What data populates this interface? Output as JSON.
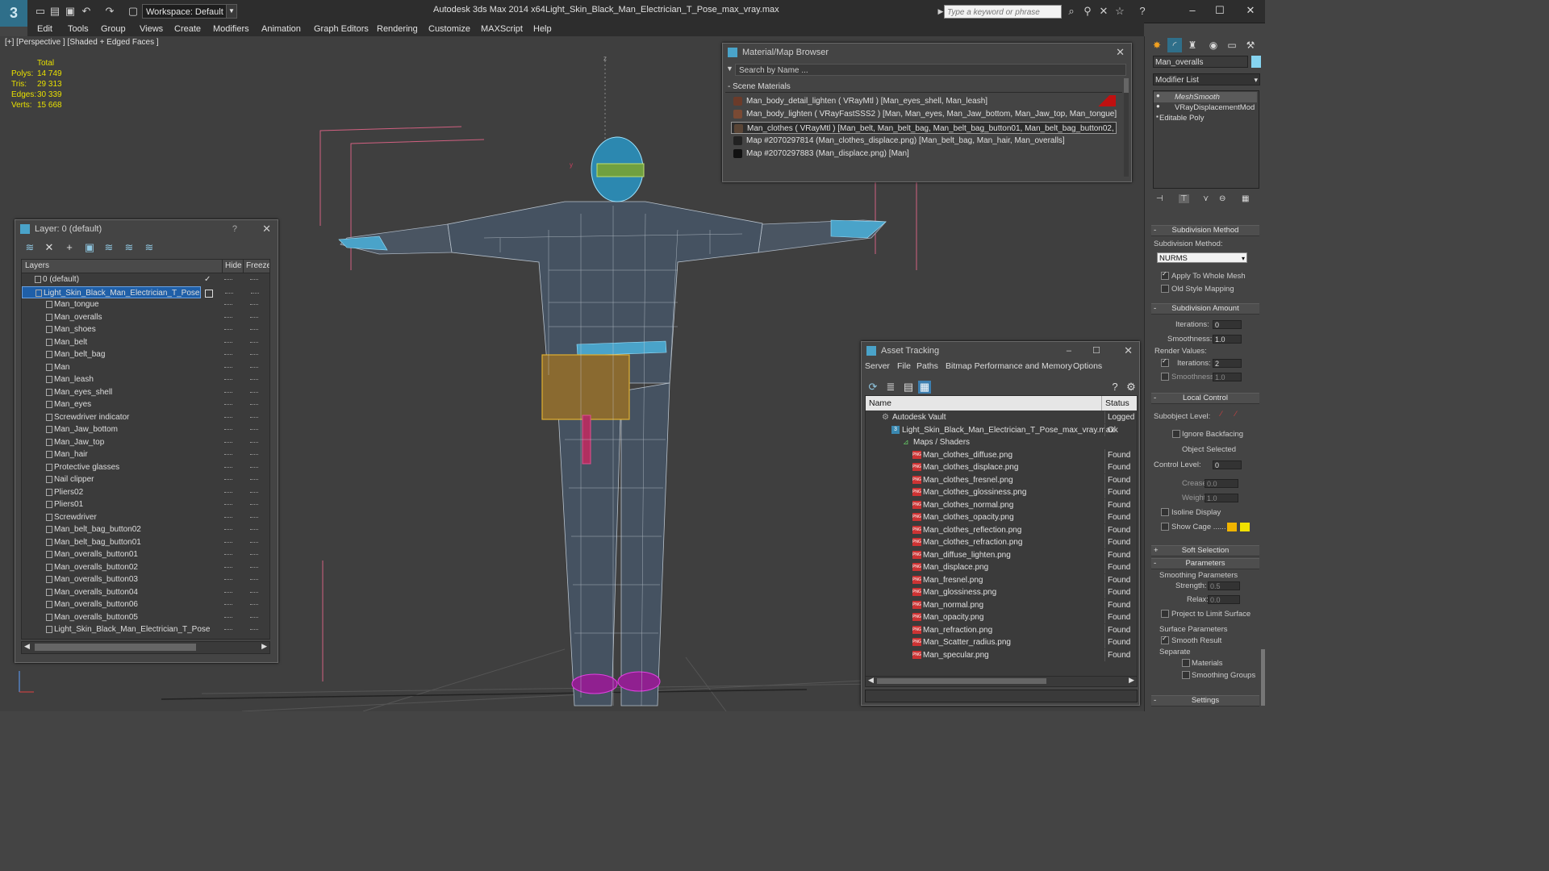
{
  "app": {
    "title": "Autodesk 3ds Max  2014 x64",
    "file": "Light_Skin_Black_Man_Electrician_T_Pose_max_vray.max",
    "workspace": "Workspace: Default",
    "search_placeholder": "Type a keyword or phrase",
    "menu": [
      "Edit",
      "Tools",
      "Group",
      "Views",
      "Create",
      "Modifiers",
      "Animation",
      "Graph Editors",
      "Rendering",
      "Customize",
      "MAXScript",
      "Help"
    ]
  },
  "viewport": {
    "label": "[+] [Perspective ] [Shaded + Edged Faces ]",
    "stats": {
      "total_label": "Total",
      "rows": [
        {
          "k": "Polys:",
          "v": "14 749"
        },
        {
          "k": "Tris:",
          "v": "29 313"
        },
        {
          "k": "Edges:",
          "v": "30 339"
        },
        {
          "k": "Verts:",
          "v": "15 668"
        }
      ]
    },
    "axis_z": "z",
    "axis_y": "y"
  },
  "material_browser": {
    "title": "Material/Map Browser",
    "search_placeholder": "Search by Name ...",
    "section": "- Scene Materials",
    "items": [
      {
        "label": "Man_body_detail_lighten  ( VRayMtl ) [Man_eyes_shell, Man_leash]",
        "swatch": "#6b3b2a"
      },
      {
        "label": "Man_body_lighten  ( VRayFastSSS2 ) [Man, Man_eyes, Man_Jaw_bottom, Man_Jaw_top, Man_tongue]",
        "swatch": "#7a4a34"
      },
      {
        "label": "Man_clothes  ( VRayMtl ) [Man_belt, Man_belt_bag, Man_belt_bag_button01, Man_belt_bag_button02, Man_...",
        "swatch": "#5a4536"
      },
      {
        "label": "Map #2070297814 (Man_clothes_displace.png) [Man_belt_bag, Man_hair, Man_overalls]",
        "swatch": "#222222"
      },
      {
        "label": "Map #2070297883 (Man_displace.png) [Man]",
        "swatch": "#111111"
      }
    ]
  },
  "layer_panel": {
    "title": "Layer: 0 (default)",
    "help": "?",
    "col_layers": "Layers",
    "col_hide": "Hide",
    "col_freeze": "Freeze",
    "rows": [
      {
        "label": "0 (default)",
        "indent": 1,
        "type": "layer",
        "check": "✓"
      },
      {
        "label": "Light_Skin_Black_Man_Electrician_T_Pose",
        "indent": 1,
        "type": "layer",
        "selected": true
      },
      {
        "label": "Man_tongue",
        "indent": 2
      },
      {
        "label": "Man_overalls",
        "indent": 2
      },
      {
        "label": "Man_shoes",
        "indent": 2
      },
      {
        "label": "Man_belt",
        "indent": 2
      },
      {
        "label": "Man_belt_bag",
        "indent": 2
      },
      {
        "label": "Man",
        "indent": 2
      },
      {
        "label": "Man_leash",
        "indent": 2
      },
      {
        "label": "Man_eyes_shell",
        "indent": 2
      },
      {
        "label": "Man_eyes",
        "indent": 2
      },
      {
        "label": "Screwdriver indicator",
        "indent": 2
      },
      {
        "label": "Man_Jaw_bottom",
        "indent": 2
      },
      {
        "label": "Man_Jaw_top",
        "indent": 2
      },
      {
        "label": "Man_hair",
        "indent": 2
      },
      {
        "label": "Protective glasses",
        "indent": 2
      },
      {
        "label": "Nail clipper",
        "indent": 2
      },
      {
        "label": "Pliers02",
        "indent": 2
      },
      {
        "label": "Pliers01",
        "indent": 2
      },
      {
        "label": "Screwdriver",
        "indent": 2
      },
      {
        "label": "Man_belt_bag_button02",
        "indent": 2
      },
      {
        "label": "Man_belt_bag_button01",
        "indent": 2
      },
      {
        "label": "Man_overalls_button01",
        "indent": 2
      },
      {
        "label": "Man_overalls_button02",
        "indent": 2
      },
      {
        "label": "Man_overalls_button03",
        "indent": 2
      },
      {
        "label": "Man_overalls_button04",
        "indent": 2
      },
      {
        "label": "Man_overalls_button06",
        "indent": 2
      },
      {
        "label": "Man_overalls_button05",
        "indent": 2
      },
      {
        "label": "Light_Skin_Black_Man_Electrician_T_Pose",
        "indent": 2
      }
    ]
  },
  "asset_tracking": {
    "title": "Asset Tracking",
    "menu": [
      "Server",
      "File",
      "Paths",
      "Bitmap Performance and Memory",
      "Options"
    ],
    "col_name": "Name",
    "col_status": "Status",
    "rows": [
      {
        "label": "Autodesk Vault",
        "status": "Logged O",
        "level": 0,
        "type": "vault"
      },
      {
        "label": "Light_Skin_Black_Man_Electrician_T_Pose_max_vray.max",
        "status": "Ok",
        "level": 1,
        "type": "max"
      },
      {
        "label": "Maps / Shaders",
        "status": "",
        "level": 2,
        "type": "folder"
      },
      {
        "label": "Man_clothes_diffuse.png",
        "status": "Found",
        "level": 3,
        "type": "png"
      },
      {
        "label": "Man_clothes_displace.png",
        "status": "Found",
        "level": 3,
        "type": "png"
      },
      {
        "label": "Man_clothes_fresnel.png",
        "status": "Found",
        "level": 3,
        "type": "png"
      },
      {
        "label": "Man_clothes_glossiness.png",
        "status": "Found",
        "level": 3,
        "type": "png"
      },
      {
        "label": "Man_clothes_normal.png",
        "status": "Found",
        "level": 3,
        "type": "png"
      },
      {
        "label": "Man_clothes_opacity.png",
        "status": "Found",
        "level": 3,
        "type": "png"
      },
      {
        "label": "Man_clothes_reflection.png",
        "status": "Found",
        "level": 3,
        "type": "png"
      },
      {
        "label": "Man_clothes_refraction.png",
        "status": "Found",
        "level": 3,
        "type": "png"
      },
      {
        "label": "Man_diffuse_lighten.png",
        "status": "Found",
        "level": 3,
        "type": "png"
      },
      {
        "label": "Man_displace.png",
        "status": "Found",
        "level": 3,
        "type": "png"
      },
      {
        "label": "Man_fresnel.png",
        "status": "Found",
        "level": 3,
        "type": "png"
      },
      {
        "label": "Man_glossiness.png",
        "status": "Found",
        "level": 3,
        "type": "png"
      },
      {
        "label": "Man_normal.png",
        "status": "Found",
        "level": 3,
        "type": "png"
      },
      {
        "label": "Man_opacity.png",
        "status": "Found",
        "level": 3,
        "type": "png"
      },
      {
        "label": "Man_refraction.png",
        "status": "Found",
        "level": 3,
        "type": "png"
      },
      {
        "label": "Man_Scatter_radius.png",
        "status": "Found",
        "level": 3,
        "type": "png"
      },
      {
        "label": "Man_specular.png",
        "status": "Found",
        "level": 3,
        "type": "png"
      }
    ]
  },
  "command_panel": {
    "object_name": "Man_overalls",
    "object_color": "#86d4f0",
    "modifier_list": "Modifier List",
    "stack": [
      "MeshSmooth",
      "VRayDisplacementMod",
      "Editable Poly"
    ],
    "subdivision_method_hdr": "Subdivision Method",
    "subdivision_method_label": "Subdivision Method:",
    "subdivision_method_value": "NURMS",
    "apply_whole_mesh": "Apply To Whole Mesh",
    "old_style_mapping": "Old Style Mapping",
    "subdivision_amount_hdr": "Subdivision Amount",
    "iterations_label": "Iterations:",
    "iterations_value": "0",
    "smoothness_label": "Smoothness:",
    "smoothness_value": "1.0",
    "render_values": "Render Values:",
    "r_iterations_label": "Iterations:",
    "r_iterations_value": "2",
    "r_smoothness_label": "Smoothness:",
    "r_smoothness_value": "1.0",
    "local_control_hdr": "Local Control",
    "subobject_level": "Subobject Level:",
    "ignore_backfacing": "Ignore Backfacing",
    "object_selected": "Object Selected",
    "control_level_label": "Control Level:",
    "control_level_value": "0",
    "crease_label": "Crease:",
    "crease_value": "0.0",
    "weight_label": "Weight:",
    "weight_value": "1.0",
    "isoline_display": "Isoline Display",
    "show_cage": "Show Cage ......",
    "soft_selection_hdr": "Soft Selection",
    "parameters_hdr": "Parameters",
    "smoothing_params": "Smoothing Parameters",
    "strength_label": "Strength:",
    "strength_value": "0.5",
    "relax_label": "Relax:",
    "relax_value": "0.0",
    "project_limit": "Project to Limit Surface",
    "surface_params": "Surface Parameters",
    "smooth_result": "Smooth Result",
    "separate": "Separate",
    "materials": "Materials",
    "smoothing_groups": "Smoothing Groups",
    "settings_hdr": "Settings",
    "cage_color_1": "#f0b400",
    "cage_color_2": "#f0e000"
  }
}
